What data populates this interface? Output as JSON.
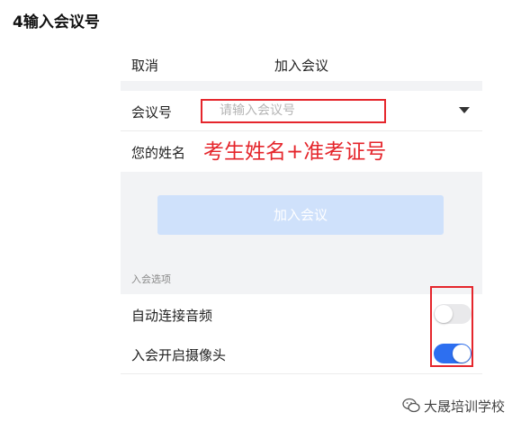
{
  "heading": "4输入会议号",
  "navbar": {
    "cancel": "取消",
    "title": "加入会议"
  },
  "form": {
    "meeting_label": "会议号",
    "meeting_placeholder": "请输入会议号",
    "meeting_value": "",
    "name_label": "您的姓名",
    "name_value": "考生姓名+准考证号"
  },
  "join_button": "加入会议",
  "options": {
    "title": "入会选项",
    "items": [
      {
        "label": "自动连接音频",
        "enabled": false
      },
      {
        "label": "入会开启摄像头",
        "enabled": true
      }
    ]
  },
  "watermark": "大晟培训学校",
  "colors": {
    "highlight": "#e5262c",
    "toggle_on": "#2d6ff0",
    "join_button_disabled": "#cfe1fb"
  }
}
